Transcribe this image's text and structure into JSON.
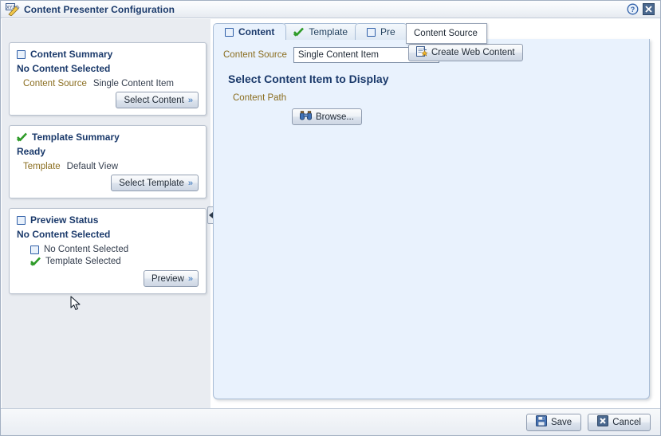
{
  "window": {
    "title": "Content Presenter Configuration",
    "icon": "xyz-pencil-icon",
    "help_icon": "help-icon",
    "close_icon": "close-icon"
  },
  "sidebar": {
    "cards": [
      {
        "icon": "unchecked-box-icon",
        "title": "Content Summary",
        "status": "No Content Selected",
        "field_label": "Content Source",
        "field_value": "Single Content Item",
        "button_label": "Select Content"
      },
      {
        "icon": "green-check-icon",
        "title": "Template Summary",
        "status": "Ready",
        "field_label": "Template",
        "field_value": "Default View",
        "button_label": "Select Template"
      },
      {
        "icon": "unchecked-box-icon",
        "title": "Preview Status",
        "status": "No Content Selected",
        "checks": [
          {
            "icon": "unchecked-box-icon",
            "label": "No Content Selected"
          },
          {
            "icon": "green-check-icon",
            "label": "Template Selected"
          }
        ],
        "button_label": "Preview"
      }
    ],
    "splitter": "collapse-left-handle"
  },
  "tabs": [
    {
      "icon": "unchecked-box-icon",
      "label": "Content",
      "active": true
    },
    {
      "icon": "green-check-icon",
      "label": "Template",
      "active": false
    },
    {
      "icon": "unchecked-box-icon",
      "label": "Pre",
      "active": false
    }
  ],
  "content_tab": {
    "source_label": "Content Source",
    "source_value": "Single Content Item",
    "create_button": "Create Web Content",
    "create_button_icon": "new-page-icon",
    "section_title": "Select Content Item to Display",
    "content_path_label": "Content Path",
    "browse_button": "Browse...",
    "browse_icon": "binoculars-icon"
  },
  "tooltip": {
    "text": "Content Source"
  },
  "footer": {
    "save_label": "Save",
    "save_icon": "floppy-save-icon",
    "cancel_label": "Cancel",
    "cancel_icon": "cancel-x-icon"
  },
  "colors": {
    "panel_blue": "#e9f2fd",
    "sidebar_gray": "#e9ecf1",
    "heading_navy": "#1b3a6b",
    "label_gold": "#8a6d1f",
    "accent_green": "#36a12e",
    "accent_blue": "#2f5fa8"
  }
}
